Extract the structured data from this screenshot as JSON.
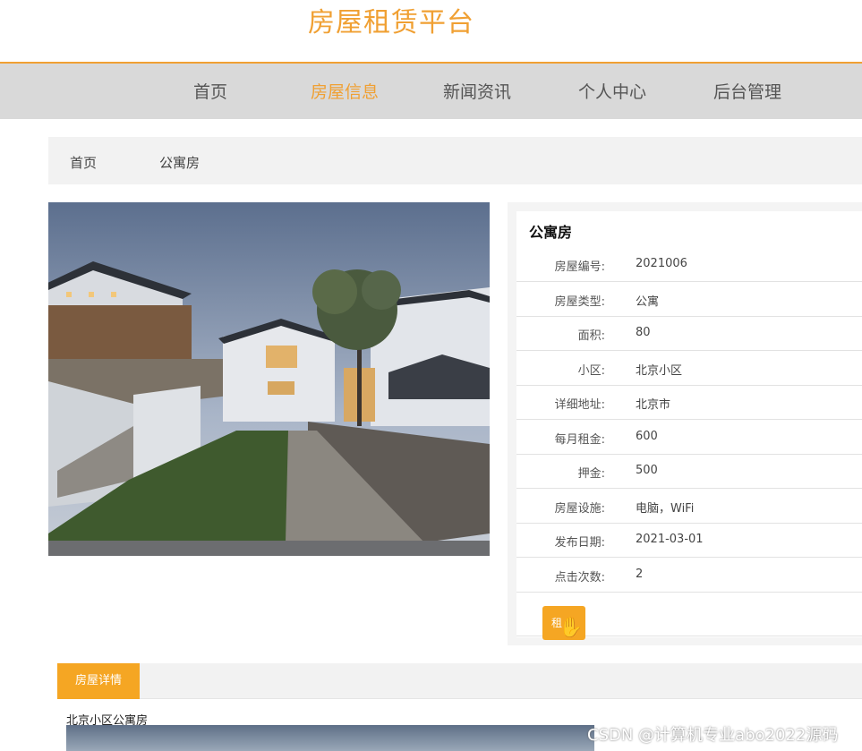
{
  "site": {
    "title": "房屋租赁平台"
  },
  "nav": {
    "items": [
      {
        "label": "首页"
      },
      {
        "label": "房屋信息",
        "active": true
      },
      {
        "label": "新闻资讯"
      },
      {
        "label": "个人中心"
      },
      {
        "label": "后台管理"
      }
    ]
  },
  "breadcrumb": {
    "home": "首页",
    "separator": "/",
    "current": "公寓房"
  },
  "house": {
    "title": "公寓房",
    "fields": [
      {
        "label": "房屋编号:",
        "value": "2021006"
      },
      {
        "label": "房屋类型:",
        "value": "公寓"
      },
      {
        "label": "面积:",
        "value": "80"
      },
      {
        "label": "小区:",
        "value": "北京小区"
      },
      {
        "label": "详细地址:",
        "value": "北京市"
      },
      {
        "label": "每月租金:",
        "value": "600"
      },
      {
        "label": "押金:",
        "value": "500"
      },
      {
        "label": "房屋设施:",
        "value": "电脑，WiFi"
      },
      {
        "label": "发布日期:",
        "value": "2021-03-01"
      },
      {
        "label": "点击次数:",
        "value": "2"
      }
    ],
    "rent_button": "租"
  },
  "detail": {
    "tab_label": "房屋详情",
    "heading": "北京小区公寓房"
  },
  "watermark": "CSDN @计算机专业abo2022源码",
  "colors": {
    "accent": "#f0a033",
    "button": "#f5a623",
    "nav_bg": "#d9d9d9"
  }
}
